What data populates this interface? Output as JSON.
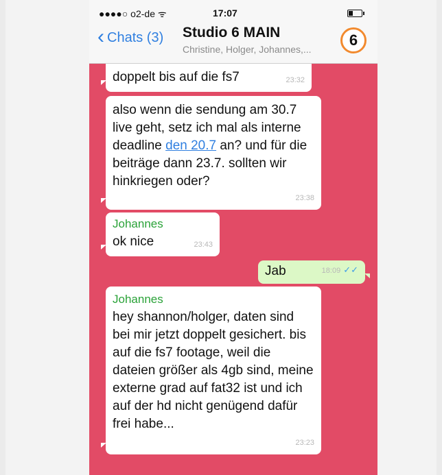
{
  "status_bar": {
    "carrier": "●●●●○ o2-de ᯤ",
    "time": "17:07"
  },
  "nav": {
    "back_label": "Chats (3)",
    "title": "Studio 6 MAIN",
    "subtitle": "Christine, Holger, Johannes,...",
    "avatar_text": "6",
    "avatar_ring_color": "#f28a2e"
  },
  "colors": {
    "chat_background": "#e24b66",
    "incoming_bubble": "#ffffff",
    "outgoing_bubble": "#dcf8c6",
    "sender_name": "#2aa238",
    "link": "#2f7fe0"
  },
  "messages": [
    {
      "text": "doppelt bis auf die fs7",
      "time": "23:32"
    },
    {
      "text_before_link": "also wenn die sendung am 30.7 live geht, setz ich mal als interne deadline ",
      "link": "den 20.7",
      "text_after_link": " an? und für die beiträge dann 23.7. sollten wir hinkriegen oder?",
      "time": "23:38"
    },
    {
      "sender": "Johannes",
      "text": "ok nice",
      "time": "23:43"
    },
    {
      "text": "Jab",
      "time": "18:09",
      "status": "read"
    },
    {
      "sender": "Johannes",
      "text": "hey shannon/holger, daten sind bei mir jetzt doppelt gesichert. bis auf die fs7 footage, weil die dateien größer als 4gb sind, meine externe grad auf fat32 ist und ich auf der hd nicht genügend dafür frei habe...",
      "time": "23:23"
    }
  ]
}
